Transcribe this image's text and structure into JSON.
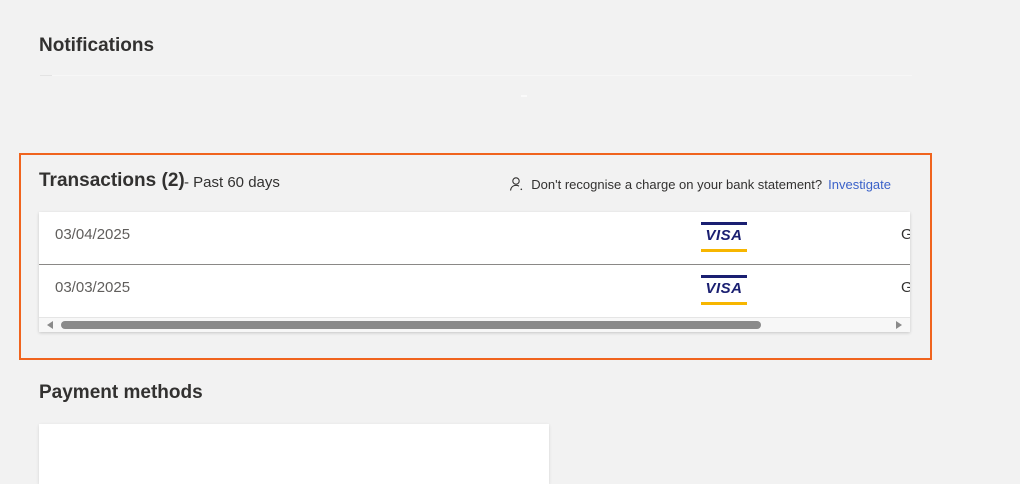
{
  "notifications": {
    "title": "Notifications"
  },
  "transactions": {
    "title": "Transactions (2)",
    "subtitle": "- Past 60 days",
    "help_text": "Don't recognise a charge on your bank statement?",
    "help_link": "Investigate",
    "rows": [
      {
        "date": "03/04/2025",
        "card_brand": "VISA",
        "truncated_text": "G"
      },
      {
        "date": "03/03/2025",
        "card_brand": "VISA",
        "truncated_text": "G"
      }
    ]
  },
  "payment_methods": {
    "title": "Payment methods"
  },
  "colors": {
    "highlight": "#f0641e",
    "link": "#3b62c9",
    "visa_blue": "#1a1f71",
    "visa_gold": "#f7b600"
  },
  "icons": {
    "help": "person-question-icon"
  }
}
